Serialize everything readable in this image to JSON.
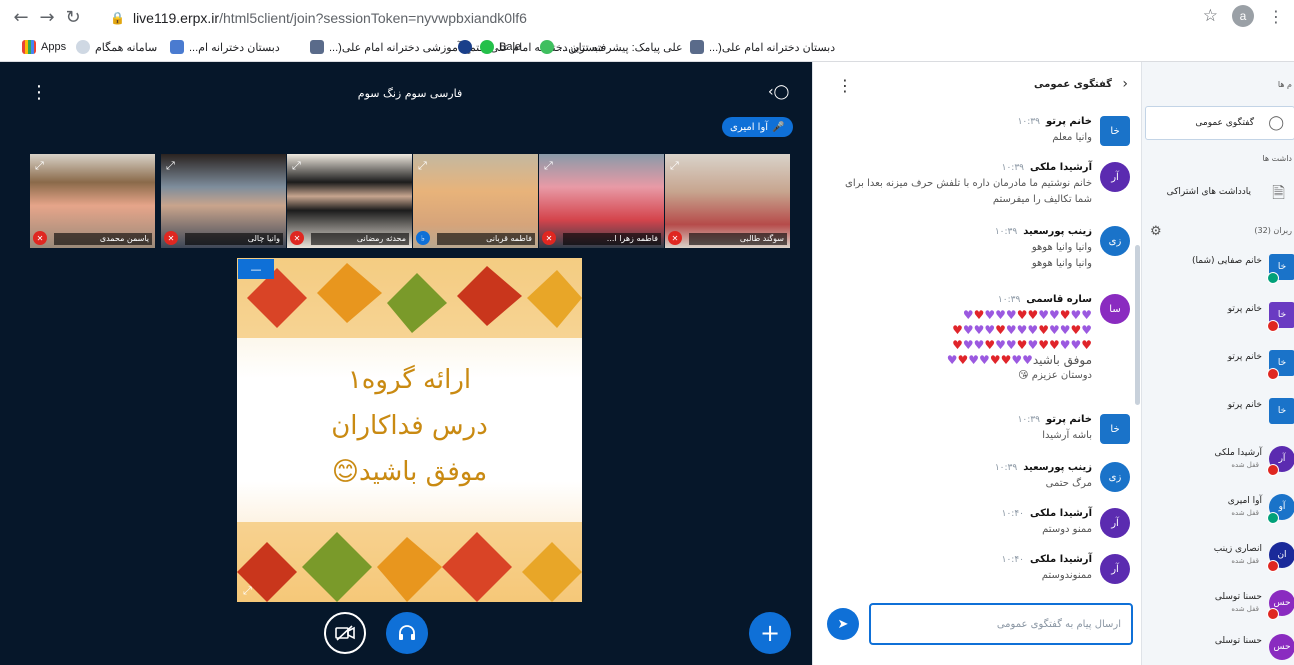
{
  "browser": {
    "url_host": "live119.erpx.ir",
    "url_path": "/html5client/join?sessionToken=nyvwpbxiandk0lf6",
    "profile_initial": "a",
    "bookmarks": [
      {
        "label": "Apps"
      },
      {
        "label": "سامانه همگام"
      },
      {
        "label": "دبستان دخترانه ام..."
      },
      {
        "label": "مجتمع آموزشی دخترانه امام علی(..."
      },
      {
        "label": "دبستان دخترانه امام علی(..."
      },
      {
        "label": "Bale"
      },
      {
        "label": "علی پیامک: پیشرفته ترین..."
      },
      {
        "label": "دبستان دخترانه امام علی(..."
      }
    ]
  },
  "presentation": {
    "title": "فارسی سوم زنگ سوم",
    "talking_indicator": "آوا امیری",
    "slide_lines": [
      "ارائه گروه۱",
      "درس فداکاران",
      "موفق باشید😊"
    ]
  },
  "video_tiles": [
    {
      "name": "سوگند طالبی"
    },
    {
      "name": "فاطمه زهرا ا..."
    },
    {
      "name": "فاطمه قربانی"
    },
    {
      "name": "محدثه رمضانی"
    },
    {
      "name": "وانیا چالی"
    },
    {
      "name": "یاسمن محمدی"
    }
  ],
  "chat": {
    "title": "گفتگوی عمومی",
    "input_placeholder": "ارسال پیام به گفتگوی عمومی",
    "messages": [
      {
        "initials": "خا",
        "name": "خانم پرتو",
        "time": "۱۰:۳۹",
        "lines": [
          "وانیا معلم"
        ],
        "color": "#1a73c9"
      },
      {
        "initials": "آر",
        "name": "آرشیدا ملکی",
        "time": "۱۰:۳۹",
        "lines": [
          "خانم نوشتیم ما مادرمان داره با تلفش حرف میزنه بعدا برای شما تکالیف را میفرستم"
        ],
        "color": "#5b2bb0"
      },
      {
        "initials": "زی",
        "name": "زینب پورسعید",
        "time": "۱۰:۳۹",
        "lines": [
          "وانیا وانیا هوهو",
          "وانیا وانیا هوهو"
        ],
        "color": "#1a73c9"
      },
      {
        "initials": "سا",
        "name": "ساره قاسمی",
        "time": "۱۰:۳۹",
        "lines": [
          "موفق باشید",
          "دوستان عزیزم 😘"
        ],
        "color": "#8a2bc0"
      },
      {
        "initials": "خا",
        "name": "خانم پرتو",
        "time": "۱۰:۳۹",
        "lines": [
          "باشه آرشیدا"
        ],
        "color": "#1a73c9"
      },
      {
        "initials": "زی",
        "name": "زینب پورسعید",
        "time": "۱۰:۳۹",
        "lines": [
          "مرگ حتمی"
        ],
        "color": "#1a73c9"
      },
      {
        "initials": "آر",
        "name": "آرشیدا ملکی",
        "time": "۱۰:۴۰",
        "lines": [
          "ممنو دوستم"
        ],
        "color": "#5b2bb0"
      },
      {
        "initials": "آر",
        "name": "آرشیدا ملکی",
        "time": "۱۰:۴۰",
        "lines": [
          "ممنوندوستم"
        ],
        "color": "#5b2bb0"
      }
    ]
  },
  "users_panel": {
    "messages_label": "م ها",
    "public_chat": "گفتگوی عمومی",
    "notes_label": "داشت ها",
    "shared_notes": "یادداشت های اشتراکی",
    "users_label": "ربران (32)",
    "users": [
      {
        "initials": "خا",
        "name": "خانم صفایی (شما)",
        "status": "",
        "shape": "sq",
        "color": "#1a73c9",
        "badge": "g"
      },
      {
        "initials": "خا",
        "name": "خانم پرتو",
        "status": "",
        "shape": "sq",
        "color": "#6a3bc2",
        "badge": "r"
      },
      {
        "initials": "خا",
        "name": "خانم پرتو",
        "status": "",
        "shape": "sq",
        "color": "#1a73c9",
        "badge": "r"
      },
      {
        "initials": "خا",
        "name": "خانم پرتو",
        "status": "",
        "shape": "sq",
        "color": "#1a73c9",
        "badge": ""
      },
      {
        "initials": "آر",
        "name": "آرشیدا ملکی",
        "status": "قفل شده",
        "shape": "rd",
        "color": "#5b2bb0",
        "badge": "r"
      },
      {
        "initials": "آو",
        "name": "آوا امیری",
        "status": "قفل شده",
        "shape": "rd",
        "color": "#1a73c9",
        "badge": "g"
      },
      {
        "initials": "ان",
        "name": "انصاری زینب",
        "status": "قفل شده",
        "shape": "rd",
        "color": "#1a2a9a",
        "badge": "r"
      },
      {
        "initials": "حس",
        "name": "حسنا توسلی",
        "status": "قفل شده",
        "shape": "rd",
        "color": "#8a2bc0",
        "badge": "r"
      },
      {
        "initials": "حس",
        "name": "حسنا توسلی",
        "status": "",
        "shape": "rd",
        "color": "#8a2bc0",
        "badge": ""
      }
    ]
  }
}
